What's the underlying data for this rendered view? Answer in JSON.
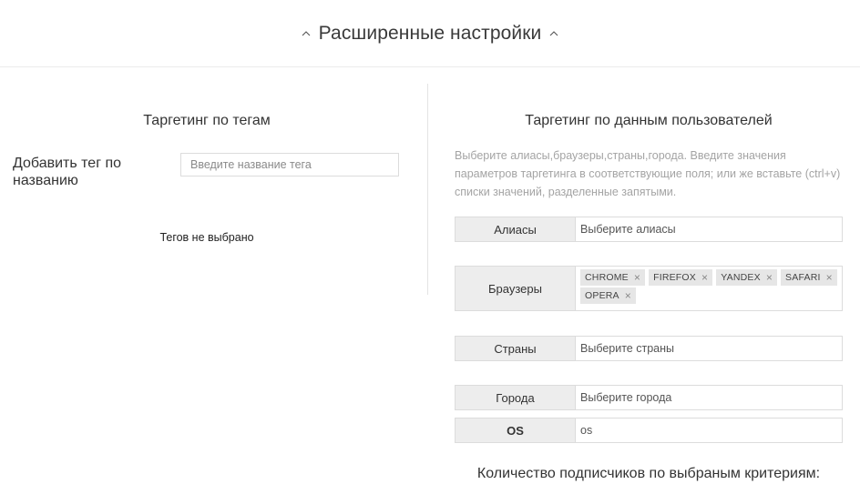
{
  "header": {
    "title": "Расширенные настройки"
  },
  "tags": {
    "title": "Таргетинг по тегам",
    "add_label": "Добавить тег по названию",
    "input_placeholder": "Введите название тега",
    "empty_text": "Тегов не выбрано"
  },
  "users": {
    "title": "Таргетинг по данным пользователей",
    "hint": "Выберите алиасы,браузеры,страны,города. Введите значения параметров таргетинга в соответствующие поля; или же вставьте (ctrl+v) списки значений, разделенные запятыми.",
    "aliases": {
      "label": "Алиасы",
      "placeholder": "Выберите алиасы"
    },
    "browsers": {
      "label": "Браузеры",
      "selected": [
        "CHROME",
        "FIREFOX",
        "YANDEX",
        "SAFARI",
        "OPERA"
      ]
    },
    "countries": {
      "label": "Страны",
      "placeholder": "Выберите страны"
    },
    "cities": {
      "label": "Города",
      "placeholder": "Выберите города"
    },
    "os": {
      "label": "OS",
      "value": "os"
    },
    "subscribers_text": "Количество подписчиков по выбраным критериям:"
  },
  "icons": {
    "collapse": "chevron-up-icon",
    "remove_chip": "close-icon"
  },
  "colors": {
    "label_bg": "#ededed",
    "border": "#dcdcdc",
    "chip_bg": "#e6e6e6",
    "hint_text": "#a4a4a4"
  }
}
